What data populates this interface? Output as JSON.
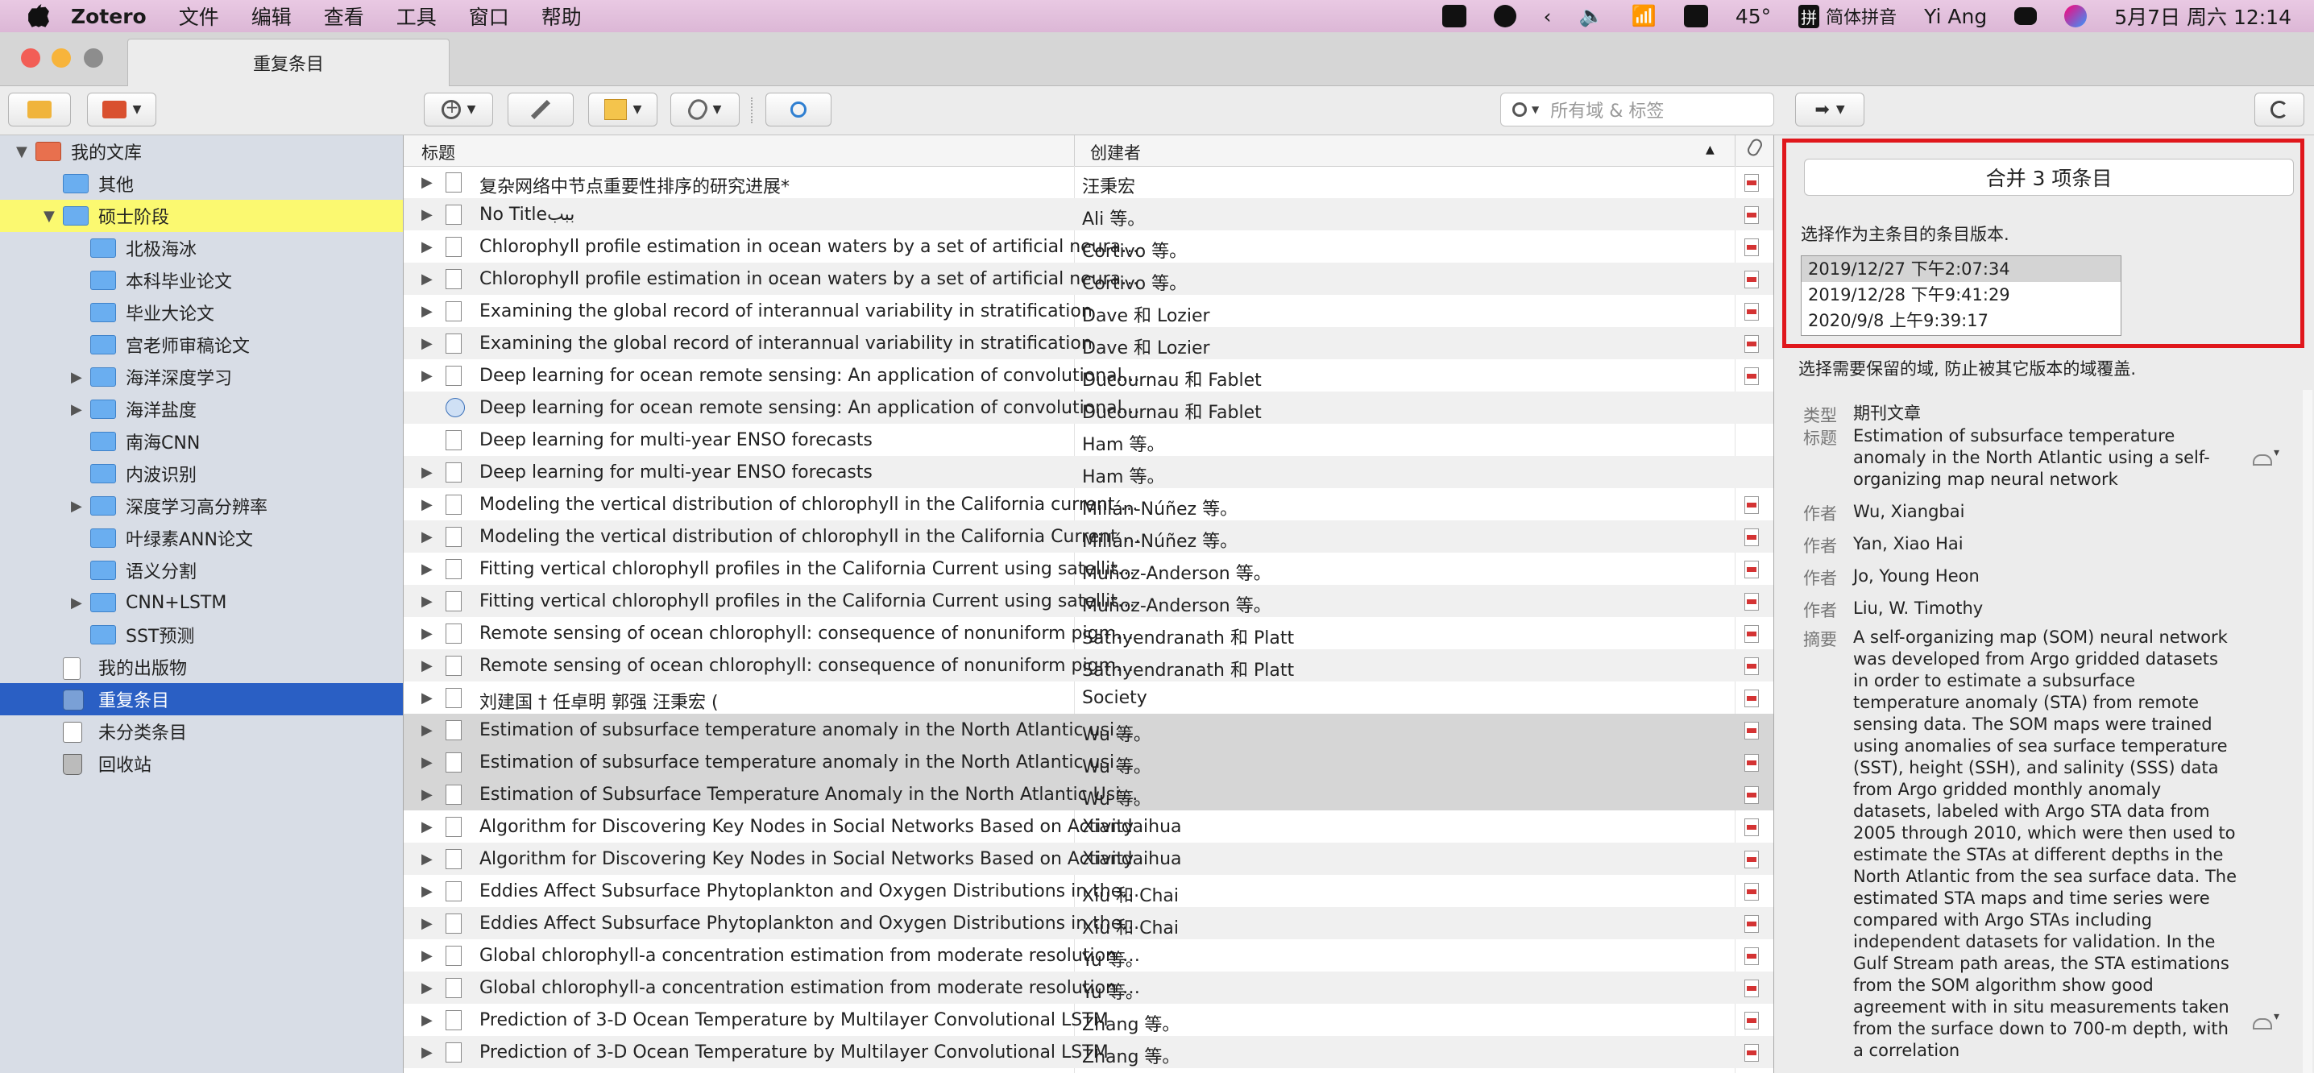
{
  "menubar": {
    "app": "Zotero",
    "menus": [
      "文件",
      "编辑",
      "查看",
      "工具",
      "窗口",
      "帮助"
    ],
    "temp": "45°",
    "ime": "拼",
    "ime_label": "简体拼音",
    "user": "Yi Ang",
    "datetime": "5月7日 周六  12:14"
  },
  "window": {
    "tab_title": "重复条目"
  },
  "toolbar": {
    "search_placeholder": "所有域 & 标签"
  },
  "collections": [
    {
      "label": "我的文库",
      "icon": "library-icon",
      "depth": 0,
      "twisty": "▼",
      "hl": ""
    },
    {
      "label": "其他",
      "icon": "folder-icon",
      "depth": 1,
      "twisty": "",
      "hl": ""
    },
    {
      "label": "硕士阶段",
      "icon": "folder-icon",
      "depth": 1,
      "twisty": "▼",
      "hl": "yellow"
    },
    {
      "label": "北极海冰",
      "icon": "folder-icon",
      "depth": 2,
      "twisty": "",
      "hl": ""
    },
    {
      "label": "本科毕业论文",
      "icon": "folder-icon",
      "depth": 2,
      "twisty": "",
      "hl": ""
    },
    {
      "label": "毕业大论文",
      "icon": "folder-icon",
      "depth": 2,
      "twisty": "",
      "hl": ""
    },
    {
      "label": "宫老师审稿论文",
      "icon": "folder-icon",
      "depth": 2,
      "twisty": "",
      "hl": ""
    },
    {
      "label": "海洋深度学习",
      "icon": "folder-icon",
      "depth": 2,
      "twisty": "▶",
      "hl": ""
    },
    {
      "label": "海洋盐度",
      "icon": "folder-icon",
      "depth": 2,
      "twisty": "▶",
      "hl": ""
    },
    {
      "label": "南海CNN",
      "icon": "folder-icon",
      "depth": 2,
      "twisty": "",
      "hl": ""
    },
    {
      "label": "内波识别",
      "icon": "folder-icon",
      "depth": 2,
      "twisty": "",
      "hl": ""
    },
    {
      "label": "深度学习高分辨率",
      "icon": "folder-icon",
      "depth": 2,
      "twisty": "▶",
      "hl": ""
    },
    {
      "label": "叶绿素ANN论文",
      "icon": "folder-icon",
      "depth": 2,
      "twisty": "",
      "hl": ""
    },
    {
      "label": "语义分割",
      "icon": "folder-icon",
      "depth": 2,
      "twisty": "",
      "hl": ""
    },
    {
      "label": "CNN+LSTM",
      "icon": "folder-icon",
      "depth": 2,
      "twisty": "▶",
      "hl": ""
    },
    {
      "label": "SST预测",
      "icon": "folder-icon",
      "depth": 2,
      "twisty": "",
      "hl": ""
    },
    {
      "label": "我的出版物",
      "icon": "publications-icon",
      "depth": 1,
      "twisty": "",
      "hl": ""
    },
    {
      "label": "重复条目",
      "icon": "duplicates-icon",
      "depth": 1,
      "twisty": "",
      "hl": "blue"
    },
    {
      "label": "未分类条目",
      "icon": "unfiled-icon",
      "depth": 1,
      "twisty": "",
      "hl": ""
    },
    {
      "label": "回收站",
      "icon": "trash-icon",
      "depth": 1,
      "twisty": "",
      "hl": ""
    }
  ],
  "items_header": {
    "title": "标题",
    "creator": "创建者",
    "sort_indicator": "▲"
  },
  "items": [
    {
      "title": "复杂网络中节点重要性排序的研究进展*",
      "creator": "汪秉宏",
      "pdf": true,
      "twisty": true,
      "icon": "doc",
      "state": ""
    },
    {
      "title": "No Titleببب",
      "creator": "Ali 等。",
      "pdf": true,
      "twisty": true,
      "icon": "doc",
      "state": ""
    },
    {
      "title": "Chlorophyll profile estimation in ocean waters by a set of artificial neural networks",
      "creator": "Cortivo 等。",
      "pdf": true,
      "twisty": true,
      "icon": "doc",
      "state": ""
    },
    {
      "title": "Chlorophyll profile estimation in ocean waters by a set of artificial neural networks",
      "creator": "Cortivo 等。",
      "pdf": true,
      "twisty": true,
      "icon": "doc",
      "state": ""
    },
    {
      "title": "Examining the global record of interannual variability in stratification",
      "creator": "Dave 和 Lozier",
      "pdf": true,
      "twisty": true,
      "icon": "doc",
      "state": ""
    },
    {
      "title": "Examining the global record of interannual variability in stratification",
      "creator": "Dave 和 Lozier",
      "pdf": true,
      "twisty": true,
      "icon": "doc",
      "state": ""
    },
    {
      "title": "Deep learning for ocean remote sensing: An application of convolutional neural networks",
      "creator": "Ducournau 和 Fablet",
      "pdf": true,
      "twisty": true,
      "icon": "doc",
      "state": ""
    },
    {
      "title": "Deep learning for ocean remote sensing: An application of convolutional neural networks",
      "creator": "Ducournau 和 Fablet",
      "pdf": false,
      "twisty": false,
      "icon": "web",
      "state": ""
    },
    {
      "title": "Deep learning for multi-year ENSO forecasts",
      "creator": "Ham 等。",
      "pdf": false,
      "twisty": false,
      "icon": "doc",
      "state": ""
    },
    {
      "title": "Deep learning for multi-year ENSO forecasts",
      "creator": "Ham 等。",
      "pdf": false,
      "twisty": true,
      "icon": "doc",
      "state": ""
    },
    {
      "title": "Modeling the vertical distribution of chlorophyll in the California current system",
      "creator": "Millán-Núñez 等。",
      "pdf": true,
      "twisty": true,
      "icon": "doc",
      "state": ""
    },
    {
      "title": "Modeling the vertical distribution of chlorophyll in the California Current System",
      "creator": "Millán-Núñez 等。",
      "pdf": true,
      "twisty": true,
      "icon": "doc",
      "state": ""
    },
    {
      "title": "Fitting vertical chlorophyll profiles in the California Current using satellite data",
      "creator": "Muñoz-Anderson 等。",
      "pdf": true,
      "twisty": true,
      "icon": "doc",
      "state": ""
    },
    {
      "title": "Fitting vertical chlorophyll profiles in the California Current using satellite data",
      "creator": "Muñoz-Anderson 等。",
      "pdf": true,
      "twisty": true,
      "icon": "doc",
      "state": ""
    },
    {
      "title": "Remote sensing of ocean chlorophyll: consequence of nonuniform pigment profile",
      "creator": "Sathyendranath 和 Platt",
      "pdf": true,
      "twisty": true,
      "icon": "doc",
      "state": ""
    },
    {
      "title": "Remote sensing of ocean chlorophyll: consequence of nonuniform pigment profile",
      "creator": "Sathyendranath 和 Platt",
      "pdf": true,
      "twisty": true,
      "icon": "doc",
      "state": ""
    },
    {
      "title": "刘建国 † 任卓明 郭强 汪秉宏 (",
      "creator": "Society",
      "pdf": true,
      "twisty": true,
      "icon": "doc",
      "state": ""
    },
    {
      "title": "Estimation of subsurface temperature anomaly in the North Atlantic using a self-organizing map neural network",
      "creator": "Wu 等。",
      "pdf": true,
      "twisty": true,
      "icon": "doc",
      "state": "sel"
    },
    {
      "title": "Estimation of subsurface temperature anomaly in the North Atlantic using a self-organizing map neural network",
      "creator": "Wu 等。",
      "pdf": true,
      "twisty": true,
      "icon": "doc",
      "state": "sel"
    },
    {
      "title": "Estimation of Subsurface Temperature Anomaly in the North Atlantic Using a Self-Organizing Map Neural Network",
      "creator": "Wu 等。",
      "pdf": true,
      "twisty": true,
      "icon": "doc",
      "state": "sel"
    },
    {
      "title": "Algorithm for Discovering Key Nodes in Social Networks Based on Activity",
      "creator": "Xiandaihua",
      "pdf": true,
      "twisty": true,
      "icon": "doc",
      "state": ""
    },
    {
      "title": "Algorithm for Discovering Key Nodes in Social Networks Based on Activity",
      "creator": "Xiandaihua",
      "pdf": true,
      "twisty": true,
      "icon": "doc",
      "state": ""
    },
    {
      "title": "Eddies Affect Subsurface Phytoplankton and Oxygen Distributions in the North Pacific",
      "creator": "Xiu 和 Chai",
      "pdf": true,
      "twisty": true,
      "icon": "doc",
      "state": ""
    },
    {
      "title": "Eddies Affect Subsurface Phytoplankton and Oxygen Distributions in the North Pacific",
      "creator": "Xiu 和 Chai",
      "pdf": true,
      "twisty": true,
      "icon": "doc",
      "state": ""
    },
    {
      "title": "Global chlorophyll-a concentration estimation from moderate resolution imaging",
      "creator": "Yu 等。",
      "pdf": true,
      "twisty": true,
      "icon": "doc",
      "state": ""
    },
    {
      "title": "Global chlorophyll-a concentration estimation from moderate resolution imaging",
      "creator": "Yu 等。",
      "pdf": true,
      "twisty": true,
      "icon": "doc",
      "state": ""
    },
    {
      "title": "Prediction of 3-D Ocean Temperature by Multilayer Convolutional LSTM",
      "creator": "Zhang 等。",
      "pdf": true,
      "twisty": true,
      "icon": "doc",
      "state": ""
    },
    {
      "title": "Prediction of 3-D Ocean Temperature by Multilayer Convolutional LSTM",
      "creator": "Zhang 等。",
      "pdf": true,
      "twisty": true,
      "icon": "doc",
      "state": ""
    }
  ],
  "merge": {
    "button": "合并 3 项条目",
    "hint": "选择作为主条目的条目版本.",
    "versions": [
      "2019/12/27 下午2:07:34",
      "2019/12/28 下午9:41:29",
      "2020/9/8 上午9:39:17"
    ],
    "selected_version": 0,
    "field_hint": "选择需要保留的域, 防止被其它版本的域覆盖."
  },
  "fields": {
    "type_label": "类型",
    "type_value": "期刊文章",
    "title_label": "标题",
    "title_value": "Estimation of subsurface temperature anomaly in the North Atlantic using a self-organizing map neural network",
    "author_label": "作者",
    "authors": [
      "Wu, Xiangbai",
      "Yan, Xiao Hai",
      "Jo, Young Heon",
      "Liu, W. Timothy"
    ],
    "abstract_label": "摘要",
    "abstract_value": "A self-organizing map (SOM) neural network was developed from Argo gridded datasets in order to estimate a subsurface temperature anomaly (STA) from remote sensing data. The SOM maps were trained using anomalies of sea surface temperature (SST), height (SSH), and salinity (SSS) data from Argo gridded monthly anomaly datasets, labeled with Argo STA data from 2005 through 2010, which were then used to estimate the STAs at different depths in the North Atlantic from the sea surface data. The estimated STA maps and time series were compared with Argo STAs including independent datasets for validation. In the Gulf Stream path areas, the STA estimations from the SOM algorithm show good agreement with in situ measurements taken from the surface down to 700-m depth, with a correlation"
  },
  "colors": {
    "accent": "#2a5fc4",
    "highlight": "#fbf970",
    "merge_border": "#e0171c"
  }
}
